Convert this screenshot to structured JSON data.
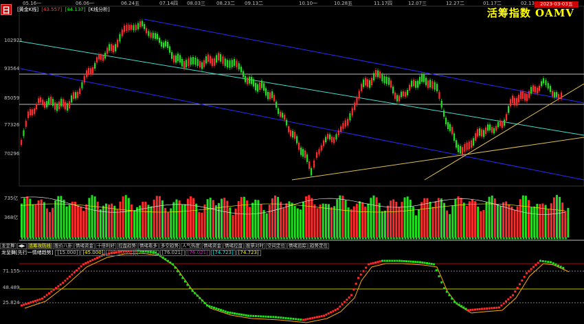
{
  "window": {
    "logo_glyph": "日",
    "date_badge": "2023-03-03五"
  },
  "header": {
    "stock_name": "[黄金K线]",
    "ma1_value": "[43.557]",
    "ma2_value": "[44.137]",
    "mode_label": "[K线分析]",
    "brand_title": "活筹指数 OAMV"
  },
  "date_axis": [
    "05.16一",
    "06.06一",
    "06.24五",
    "07.14四",
    "08.03三",
    "08.23二",
    "09.13二",
    "10.10一",
    "10.28五",
    "11.17四",
    "12.07三",
    "12.27二",
    "01.17二",
    "02.13一"
  ],
  "price_axis": [
    "102921",
    "93564",
    "85059",
    "77326",
    "70296"
  ],
  "volume_axis": [
    "735亿",
    "368亿"
  ],
  "indicator_tabs": [
    "龙呈舞",
    "◀▶",
    "活筹攻防线",
    "股价八卦",
    "情绪资金",
    "十倍利好",
    "控盘趋势",
    "情绪看多",
    "多空趋势",
    "人气热度",
    "情绪资金",
    "情绪控盘",
    "股票对时",
    "空间定位",
    "情绪追踪",
    "趋势定位"
  ],
  "indicator_values": {
    "name": "龙呈舞[先行一情绪趋势]",
    "values": [
      "[15.000]",
      "[45.000]",
      "[85.0000]",
      "[78.172]",
      "[76.021]",
      "[76.021]",
      "[74.723]",
      "[74.723]"
    ],
    "colors": [
      "#c0c0c0",
      "#ffff00",
      "#ff4040",
      "#00ff00",
      "#c0c0c0",
      "#ff00ff",
      "#00ffff",
      "#ffff00"
    ]
  },
  "indicator_axis": [
    "71.155",
    "48.489",
    "25.824"
  ],
  "colors": {
    "up": "#ff2a2a",
    "down": "#20e020",
    "channel": "#2a2aff",
    "mid": "#40e0d0",
    "support": "#e0c050",
    "grid": "#ffffff"
  },
  "chart_data": [
    {
      "type": "candlestick",
      "series": "price",
      "ylim": [
        65000,
        110000
      ],
      "y_ticks": [
        102921,
        93564,
        85059,
        77326,
        70296
      ]
    },
    {
      "type": "bar",
      "series": "volume",
      "y_ticks_labels": [
        "735亿",
        "368亿"
      ]
    },
    {
      "type": "line",
      "series": "龙呈舞",
      "ylim": [
        0,
        100
      ],
      "y_ticks": [
        71.155,
        48.489,
        25.824
      ]
    }
  ]
}
